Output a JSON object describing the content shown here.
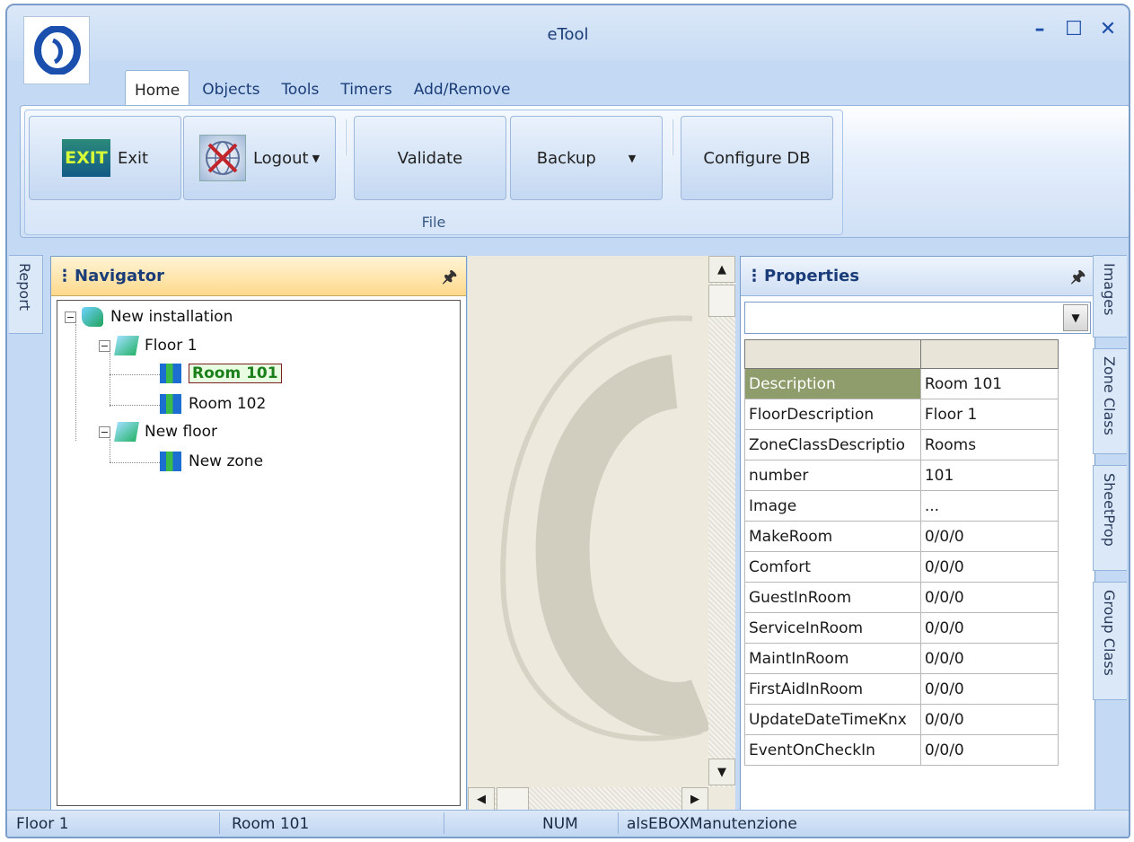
{
  "window": {
    "title": "eTool",
    "minimize": "–",
    "maximize": "☐",
    "close": "✕"
  },
  "tabs": [
    "Home",
    "Objects",
    "Tools",
    "Timers",
    "Add/Remove"
  ],
  "ribbon": {
    "group_label": "File",
    "exit_icon_text": "EXIT",
    "exit_label": "Exit",
    "logout_label": "Logout",
    "validate_label": "Validate",
    "backup_label": "Backup",
    "configure_label": "Configure DB"
  },
  "left_tabs": {
    "report": "Report"
  },
  "navigator": {
    "title": "Navigator",
    "tree": {
      "root": "New installation",
      "floor1": "Floor 1",
      "room101": "Room 101",
      "room102": "Room 102",
      "new_floor": "New floor",
      "new_zone": "New zone"
    }
  },
  "properties": {
    "title": "Properties",
    "combo_value": "",
    "rows": [
      {
        "name": "Description",
        "value": "Room 101"
      },
      {
        "name": "FloorDescription",
        "value": "Floor 1"
      },
      {
        "name": "ZoneClassDescriptio",
        "value": "Rooms"
      },
      {
        "name": "number",
        "value": "101"
      },
      {
        "name": "Image",
        "value": "..."
      },
      {
        "name": "MakeRoom",
        "value": "0/0/0"
      },
      {
        "name": "Comfort",
        "value": "0/0/0"
      },
      {
        "name": "GuestInRoom",
        "value": "0/0/0"
      },
      {
        "name": "ServiceInRoom",
        "value": "0/0/0"
      },
      {
        "name": "MaintInRoom",
        "value": "0/0/0"
      },
      {
        "name": "FirstAidInRoom",
        "value": "0/0/0"
      },
      {
        "name": "UpdateDateTimeKnx",
        "value": "0/0/0"
      },
      {
        "name": "EventOnCheckIn",
        "value": "0/0/0"
      }
    ]
  },
  "right_tabs": {
    "images": "Images",
    "zone_class": "Zone Class",
    "sheetprop": "SheetProp",
    "group_class": "Group Class"
  },
  "status": {
    "floor": "Floor 1",
    "room": "Room 101",
    "num": "NUM",
    "user": "alsEBOXManutenzione"
  }
}
